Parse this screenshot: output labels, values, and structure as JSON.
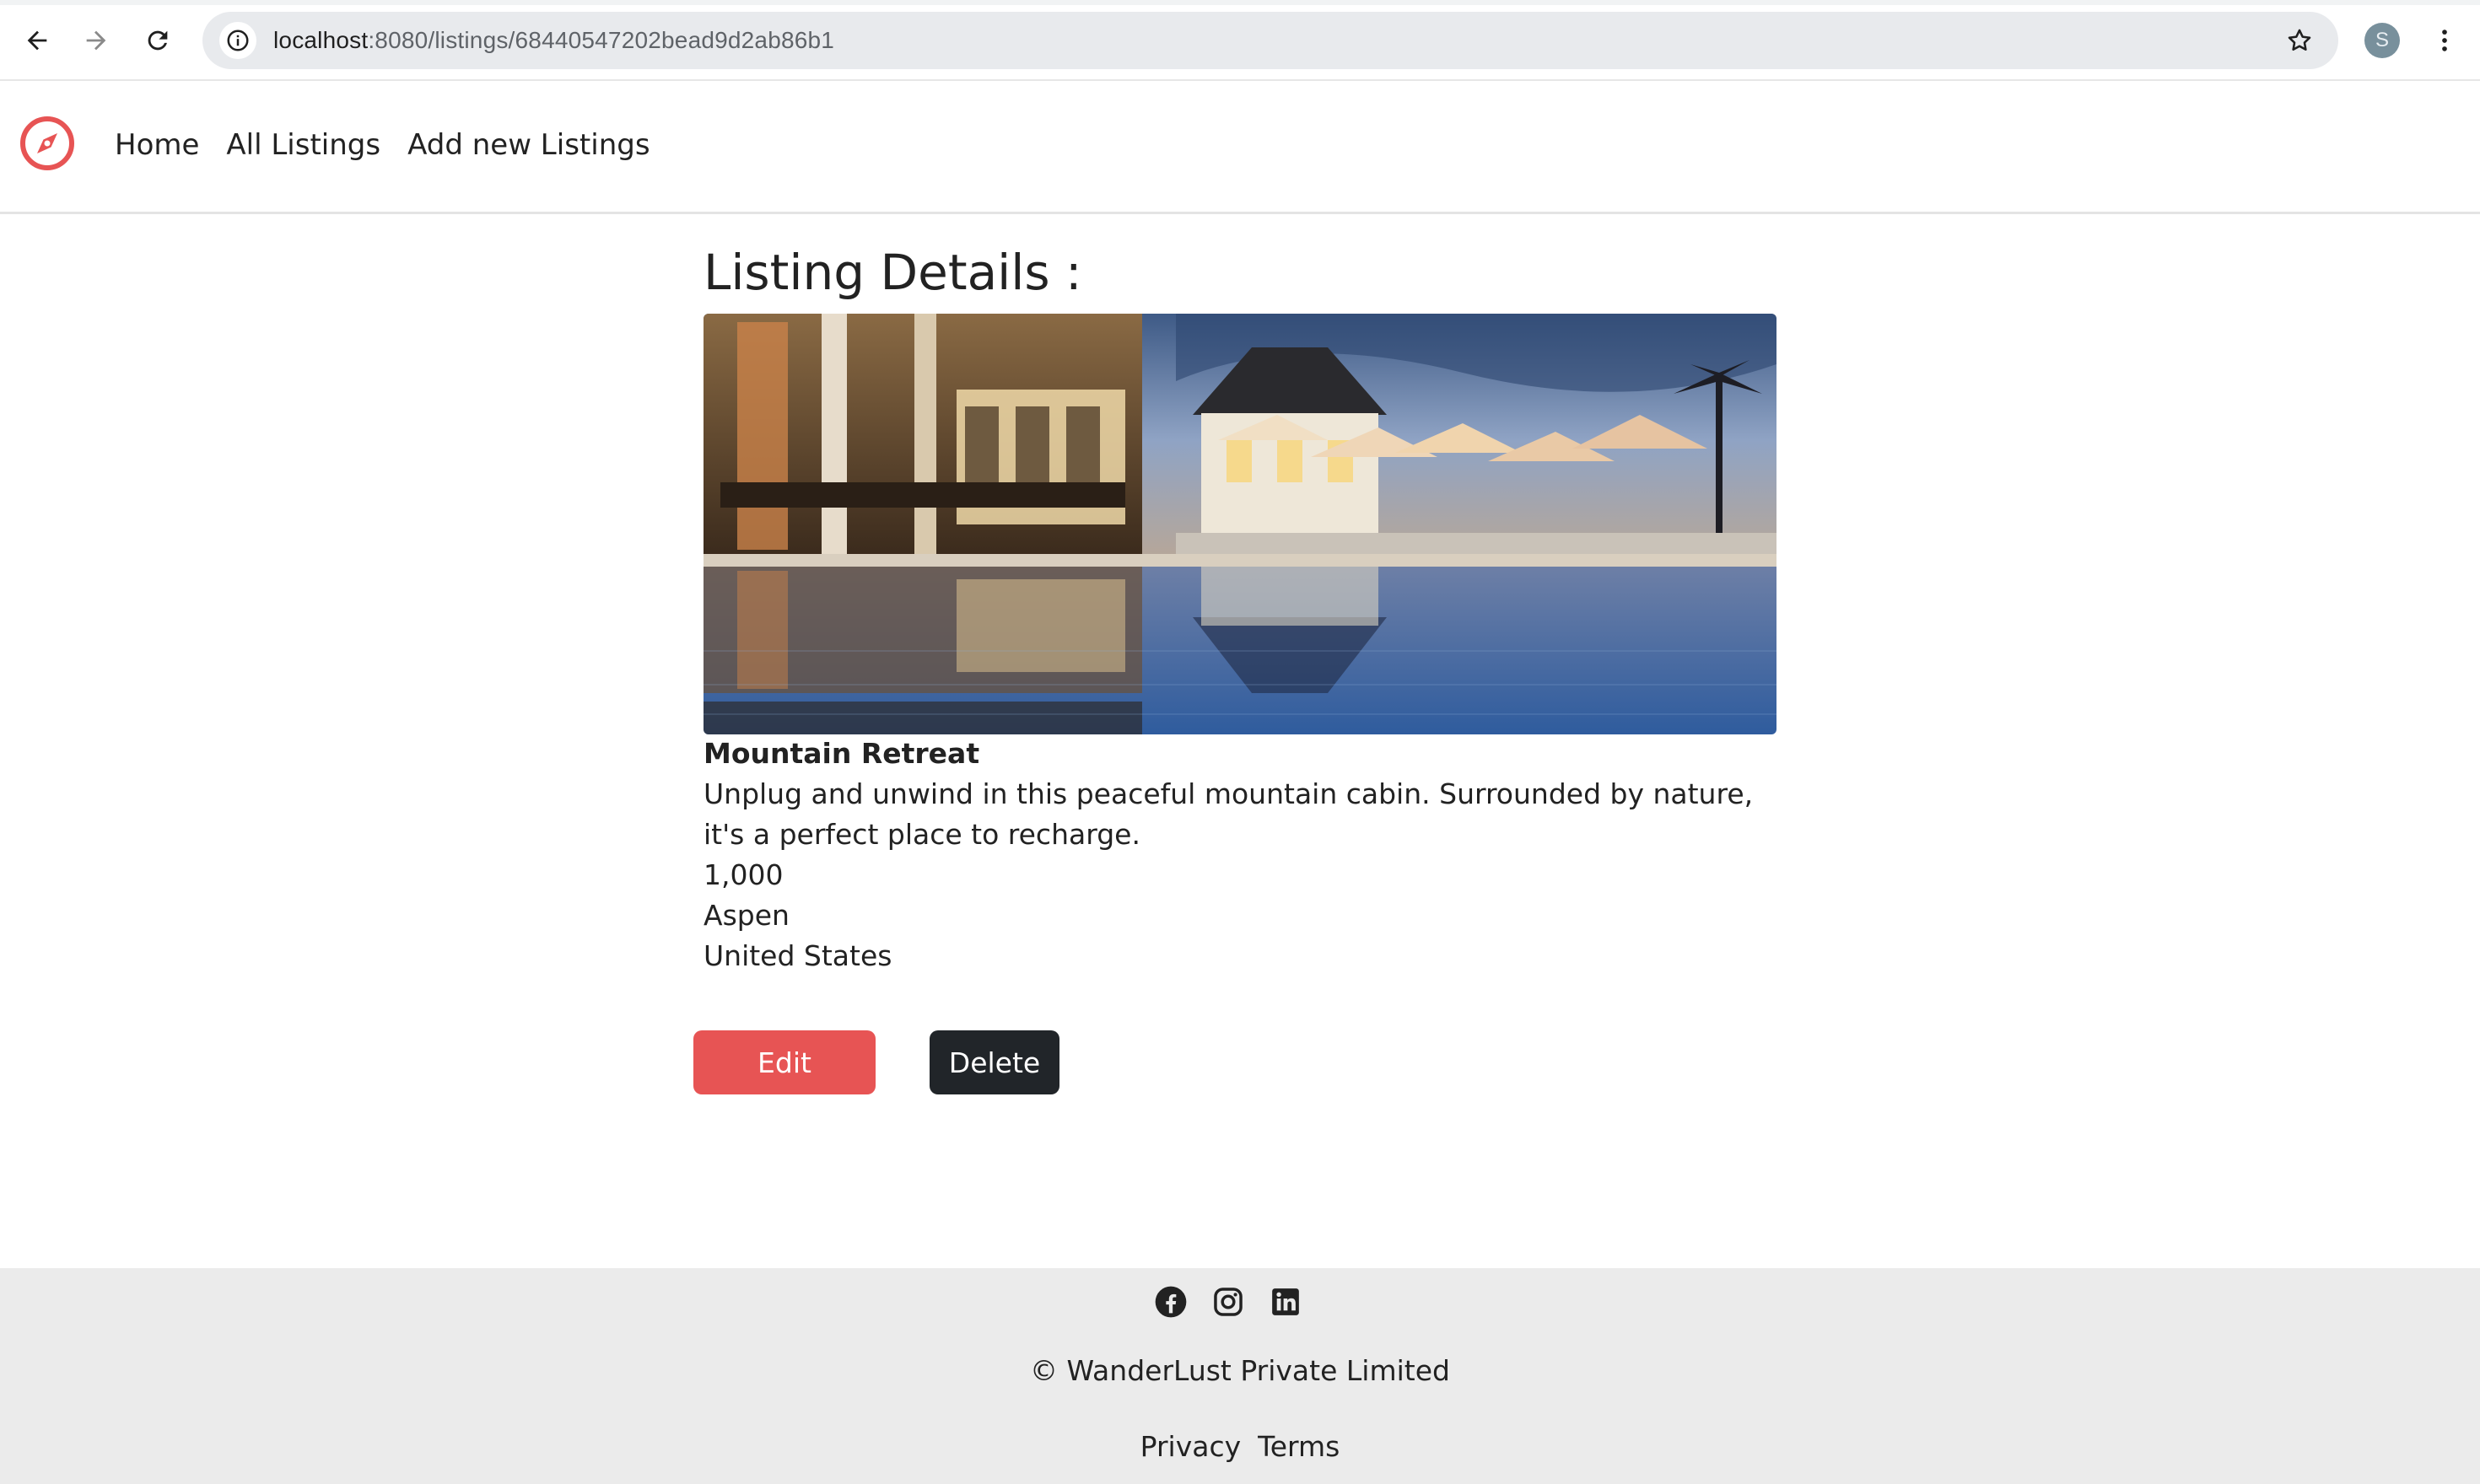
{
  "browser": {
    "url_host": "localhost",
    "url_rest": ":8080/listings/68440547202bead9d2ab86b1",
    "profile_initial": "S",
    "icons": [
      "back-icon",
      "forward-icon",
      "reload-icon",
      "site-info-icon",
      "bookmark-star-icon",
      "menu-kebab-icon"
    ]
  },
  "navbar": {
    "brand_icon": "compass-icon",
    "brand_color": "#e75454",
    "links": [
      "Home",
      "All Listings",
      "Add new Listings"
    ]
  },
  "listing": {
    "page_title": "Listing Details :",
    "image_description": "hotel-pool-terrace-photo",
    "title": "Mountain Retreat",
    "description": "Unplug and unwind in this peaceful mountain cabin. Surrounded by nature, it's a perfect place to recharge.",
    "price": "1,000",
    "location": "Aspen",
    "country": "United States"
  },
  "actions": {
    "edit_label": "Edit",
    "delete_label": "Delete",
    "edit_color": "#e75454",
    "delete_color": "#212529"
  },
  "footer": {
    "social_icons": [
      "facebook-icon",
      "instagram-icon",
      "linkedin-icon"
    ],
    "copyright": "© WanderLust Private Limited",
    "links": [
      "Privacy",
      "Terms"
    ]
  }
}
